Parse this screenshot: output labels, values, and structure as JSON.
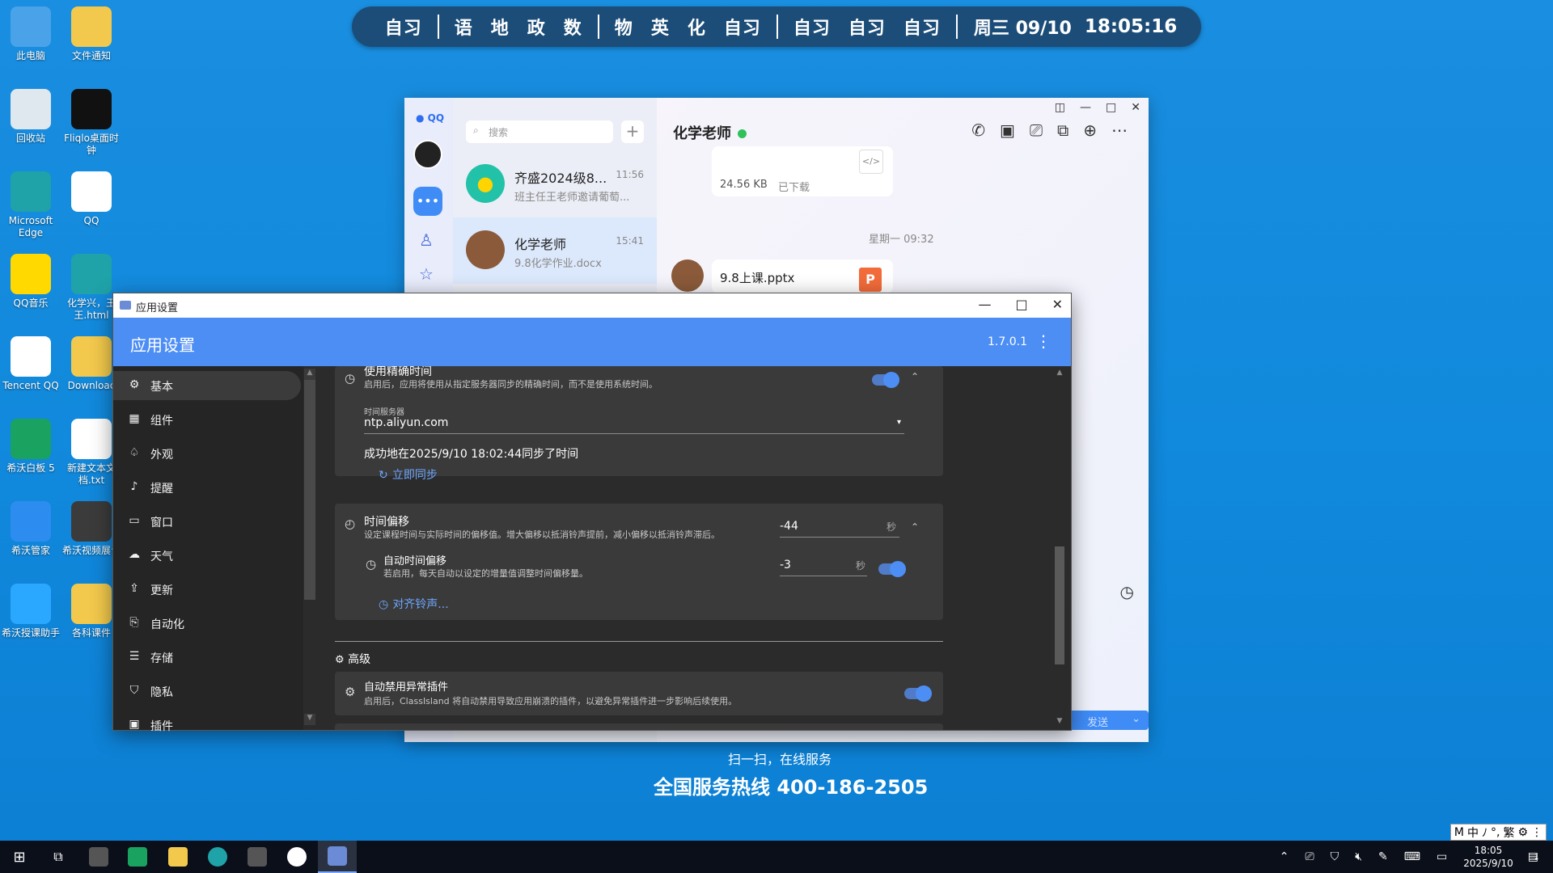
{
  "desktop_icons": [
    {
      "label": "此电脑",
      "icon": "computer-icon",
      "color": "#4aa3e8"
    },
    {
      "label": "文件通知",
      "icon": "folder-warning-icon",
      "color": "#f2c94c"
    },
    {
      "label": "回收站",
      "icon": "recycle-bin-icon",
      "color": "#dfe7ef"
    },
    {
      "label": "Fliqlo桌面时钟",
      "icon": "clock-icon",
      "color": "#111111"
    },
    {
      "label": "Microsoft Edge",
      "icon": "edge-icon",
      "color": "#1fa3a8"
    },
    {
      "label": "QQ",
      "icon": "qq-icon",
      "color": "#ffffff"
    },
    {
      "label": "QQ音乐",
      "icon": "qq-music-icon",
      "color": "#ffd900"
    },
    {
      "label": "化学兴，王王.html",
      "icon": "edge-icon",
      "color": "#1fa3a8"
    },
    {
      "label": "Tencent QQ",
      "icon": "qq-icon",
      "color": "#ffffff"
    },
    {
      "label": "Downloac",
      "icon": "folder-icon",
      "color": "#f2c94c"
    },
    {
      "label": "希沃白板 5",
      "icon": "easinote-icon",
      "color": "#1aa260"
    },
    {
      "label": "新建文本文档.txt",
      "icon": "text-file-icon",
      "color": "#ffffff"
    },
    {
      "label": "希沃管家",
      "icon": "shield-icon",
      "color": "#2d8cf0"
    },
    {
      "label": "希沃视频展台",
      "icon": "camera-icon",
      "color": "#3b3b3b"
    },
    {
      "label": "希沃授课助手",
      "icon": "link-icon",
      "color": "#2aa7ff"
    },
    {
      "label": "各科课件",
      "icon": "folder-icon",
      "color": "#f2c94c"
    }
  ],
  "schedule": {
    "items_a": [
      "自习"
    ],
    "items_b": [
      "语",
      "地",
      "政",
      "数"
    ],
    "items_c": [
      "物",
      "英",
      "化",
      "自习"
    ],
    "items_d": [
      "自习",
      "自习",
      "自习"
    ],
    "date": "周三 09/10",
    "time": "18:05:16"
  },
  "qq": {
    "search_placeholder": "搜索",
    "logo": "QQ",
    "conversations": [
      {
        "name": "齐盛2024级8...",
        "time": "11:56",
        "preview": "班主任王老师邀请葡萄..."
      },
      {
        "name": "化学老师",
        "time": "15:41",
        "preview": "9.8化学作业.docx"
      }
    ],
    "chat_title": "化学老师",
    "file1_size": "24.56 KB",
    "file1_status": "已下载",
    "day_divider": "星期一 09:32",
    "file2_name": "9.8上课.pptx",
    "file2_badge": "P",
    "send_label": "发送"
  },
  "settings": {
    "window_title": "应用设置",
    "header_title": "应用设置",
    "version": "1.7.0.1",
    "nav": [
      {
        "label": "基本",
        "icon": "gear-icon",
        "glyph": "⚙"
      },
      {
        "label": "组件",
        "icon": "widgets-icon",
        "glyph": "▦"
      },
      {
        "label": "外观",
        "icon": "appearance-icon",
        "glyph": "♤"
      },
      {
        "label": "提醒",
        "icon": "bell-icon",
        "glyph": "♪"
      },
      {
        "label": "窗口",
        "icon": "window-icon",
        "glyph": "▭"
      },
      {
        "label": "天气",
        "icon": "cloud-icon",
        "glyph": "☁"
      },
      {
        "label": "更新",
        "icon": "upload-icon",
        "glyph": "⇪"
      },
      {
        "label": "自动化",
        "icon": "automation-icon",
        "glyph": "⎘"
      },
      {
        "label": "存储",
        "icon": "database-icon",
        "glyph": "☰"
      },
      {
        "label": "隐私",
        "icon": "privacy-icon",
        "glyph": "⛉"
      },
      {
        "label": "插件",
        "icon": "plugin-icon",
        "glyph": "▣"
      }
    ],
    "precise_time": {
      "title": "使用精确时间",
      "desc": "启用后，应用将使用从指定服务器同步的精确时间，而不是使用系统时间。",
      "server_label": "时间服务器",
      "server_value": "ntp.aliyun.com",
      "sync_status": "成功地在2025/9/10 18:02:44同步了时间",
      "sync_now": "立即同步"
    },
    "offset": {
      "title": "时间偏移",
      "desc": "设定课程时间与实际时间的偏移值。增大偏移以抵消铃声提前，减小偏移以抵消铃声滞后。",
      "value": "-44",
      "unit": "秒",
      "auto_title": "自动时间偏移",
      "auto_desc": "若启用，每天自动以设定的增量值调整时间偏移量。",
      "auto_value": "-3",
      "auto_unit": "秒",
      "align_link": "对齐铃声..."
    },
    "advanced_header": "高级",
    "auto_disable": {
      "title": "自动禁用异常插件",
      "desc": "启用后，ClassIsland 将自动禁用导致应用崩溃的插件，以避免异常插件进一步影响后续使用。"
    }
  },
  "banner": {
    "line1": "扫一扫，在线服务",
    "line2": "全国服务热线 400-186-2505"
  },
  "ime": [
    "M",
    "中",
    "ﾉ",
    "°,",
    "繁",
    "⚙",
    "⋮"
  ],
  "taskbar": {
    "clock_time": "18:05",
    "clock_date": "2025/9/10",
    "notification_count": "1"
  }
}
